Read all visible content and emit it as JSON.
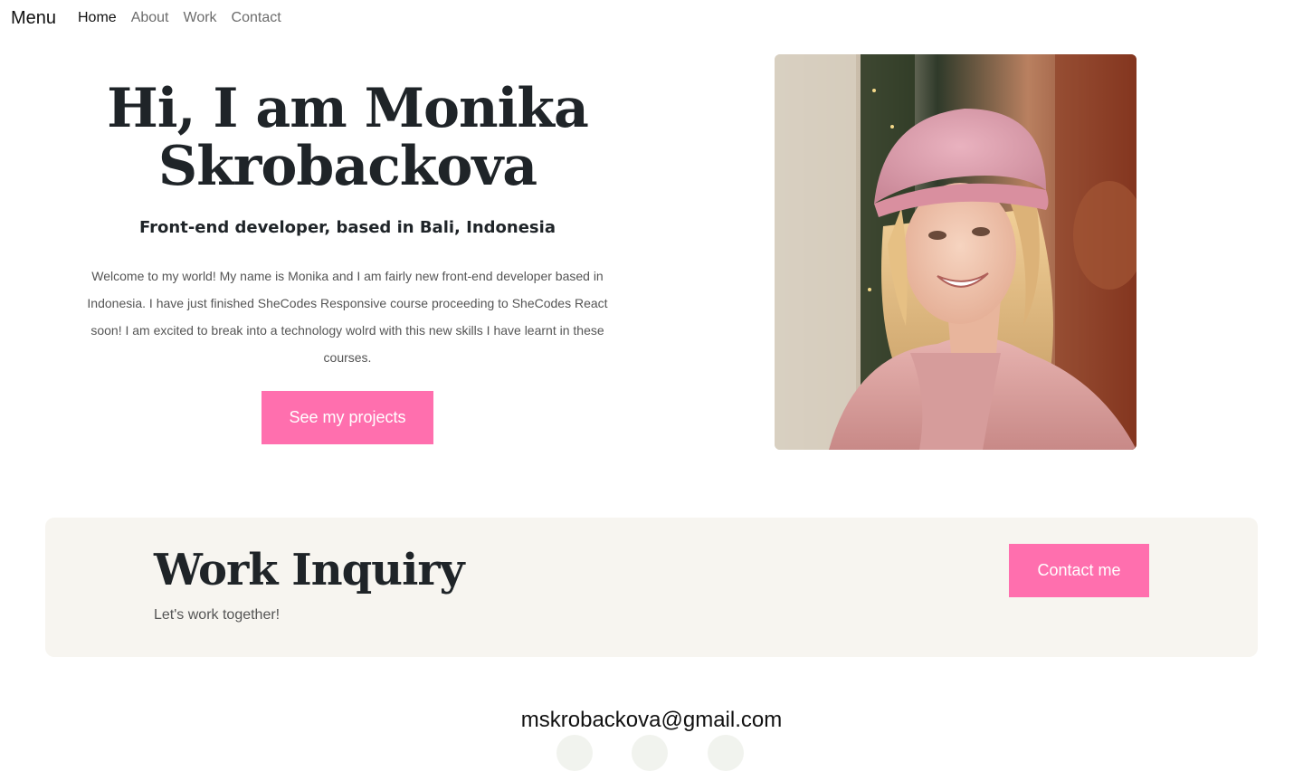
{
  "nav": {
    "brand": "Menu",
    "links": [
      {
        "label": "Home",
        "active": true
      },
      {
        "label": "About",
        "active": false
      },
      {
        "label": "Work",
        "active": false
      },
      {
        "label": "Contact",
        "active": false
      }
    ]
  },
  "hero": {
    "title_line1": "Hi, I am Monika",
    "title_line2": "Skrobackova",
    "subtitle": "Front-end developer, based in Bali, Indonesia",
    "description": "Welcome to my world! My name is Monika and I am fairly new front-end developer based in Indonesia. I have just finished SheCodes Responsive course proceeding to SheCodes React soon! I am excited to break into a technology wolrd with this new skills I have learnt in these courses.",
    "button_label": "See my projects"
  },
  "inquiry": {
    "title": "Work Inquiry",
    "subtitle": "Let's work together!",
    "button_label": "Contact me"
  },
  "footer": {
    "email": "mskrobackova@gmail.com",
    "social_icons": [
      "social-icon-1",
      "social-icon-2",
      "social-icon-3"
    ]
  },
  "colors": {
    "accent": "#ff6fae",
    "inquiry_bg": "#f7f5f0",
    "heading": "#1f2428"
  }
}
